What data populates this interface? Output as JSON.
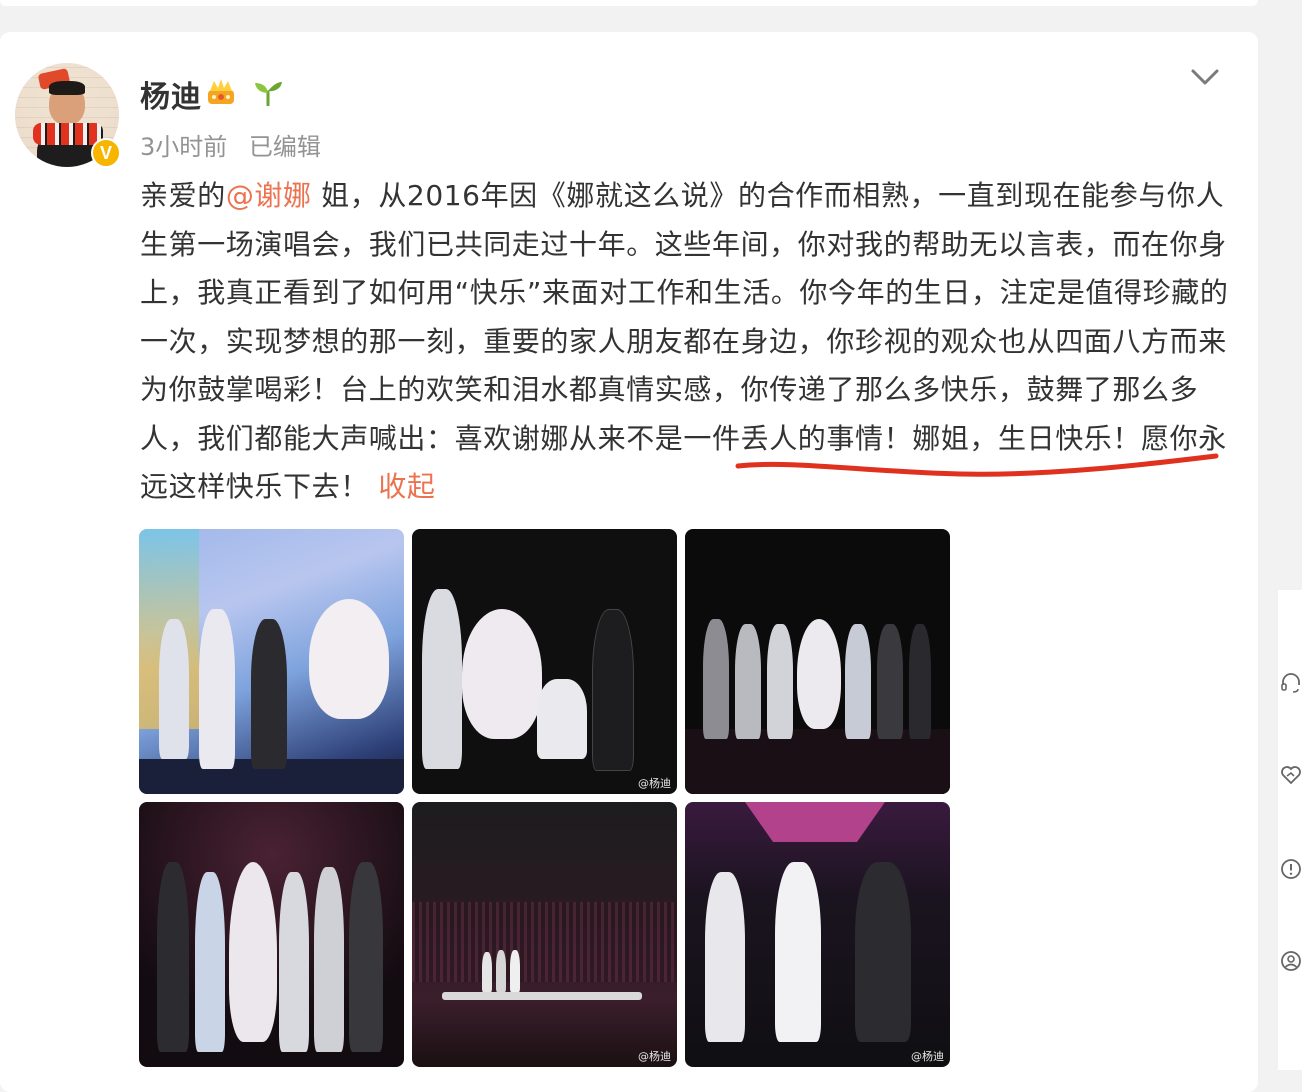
{
  "post": {
    "username": "杨迪",
    "time": "3小时前",
    "edited": "已编辑",
    "text_parts": {
      "p1": "亲爱的",
      "mention": "@谢娜",
      "p2": " 姐，从2016年因《娜就这么说》的合作而相熟，一直到现在能参与你人生第一场演唱会，我们已共同走过十年。这些年间，你对我的帮助无以言表，而在你身上，我真正看到了如何用“快乐”来面对工作和生活。你今年的生日，注定是值得珍藏的一次，实现梦想的那一刻，重要的家人朋友都在身边，你珍视的观众也从四面八方而来为你鼓掌喝彩！台上的欢笑和泪水都真情实感，你传递了那么多快乐，鼓舞了那么多人，我们都能大声喊出：喜欢谢娜从来不是一件丢人的事情！娜姐，生日快乐！愿你永远这样快乐下去！",
      "collapse": "收起"
    },
    "photos": [
      {
        "watermark": ""
      },
      {
        "watermark": "@杨迪"
      },
      {
        "watermark": ""
      },
      {
        "watermark": ""
      },
      {
        "watermark": "@杨迪"
      },
      {
        "watermark": "@杨迪"
      }
    ]
  },
  "colors": {
    "accent": "#eb7350",
    "underline": "#e0301e",
    "verified": "#f7b500"
  },
  "icons": {
    "menu": "chevron-down-icon",
    "badge_1": "crown-icon",
    "badge_2": "sprout-icon",
    "side": [
      "headset-icon",
      "heart-hand-icon",
      "alert-icon",
      "user-circle-icon"
    ]
  }
}
